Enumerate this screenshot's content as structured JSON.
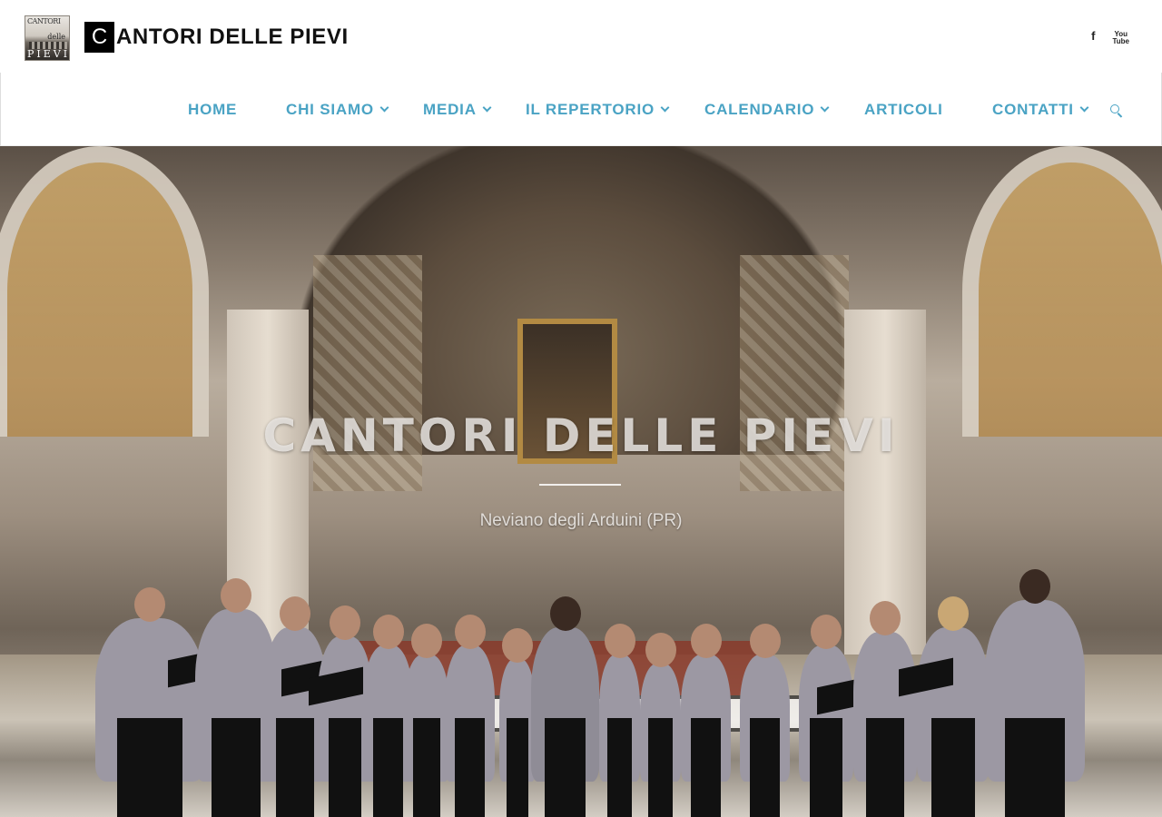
{
  "header": {
    "logo": {
      "line1": "CANTORI",
      "line2": "delle",
      "line3": "PIEVI"
    },
    "title_initial": "C",
    "title_rest": "ANTORI DELLE PIEVI",
    "social": {
      "facebook": "f",
      "youtube": "You\nTube"
    }
  },
  "nav": {
    "items": [
      {
        "label": "HOME"
      },
      {
        "label": "CHI SIAMO"
      },
      {
        "label": "MEDIA"
      },
      {
        "label": "IL REPERTORIO"
      },
      {
        "label": "CALENDARIO"
      },
      {
        "label": "ARTICOLI"
      },
      {
        "label": "CONTATTI"
      }
    ]
  },
  "hero": {
    "title": "CANTORI DELLE PIEVI",
    "subtitle": "Neviano degli Arduini (PR)"
  }
}
